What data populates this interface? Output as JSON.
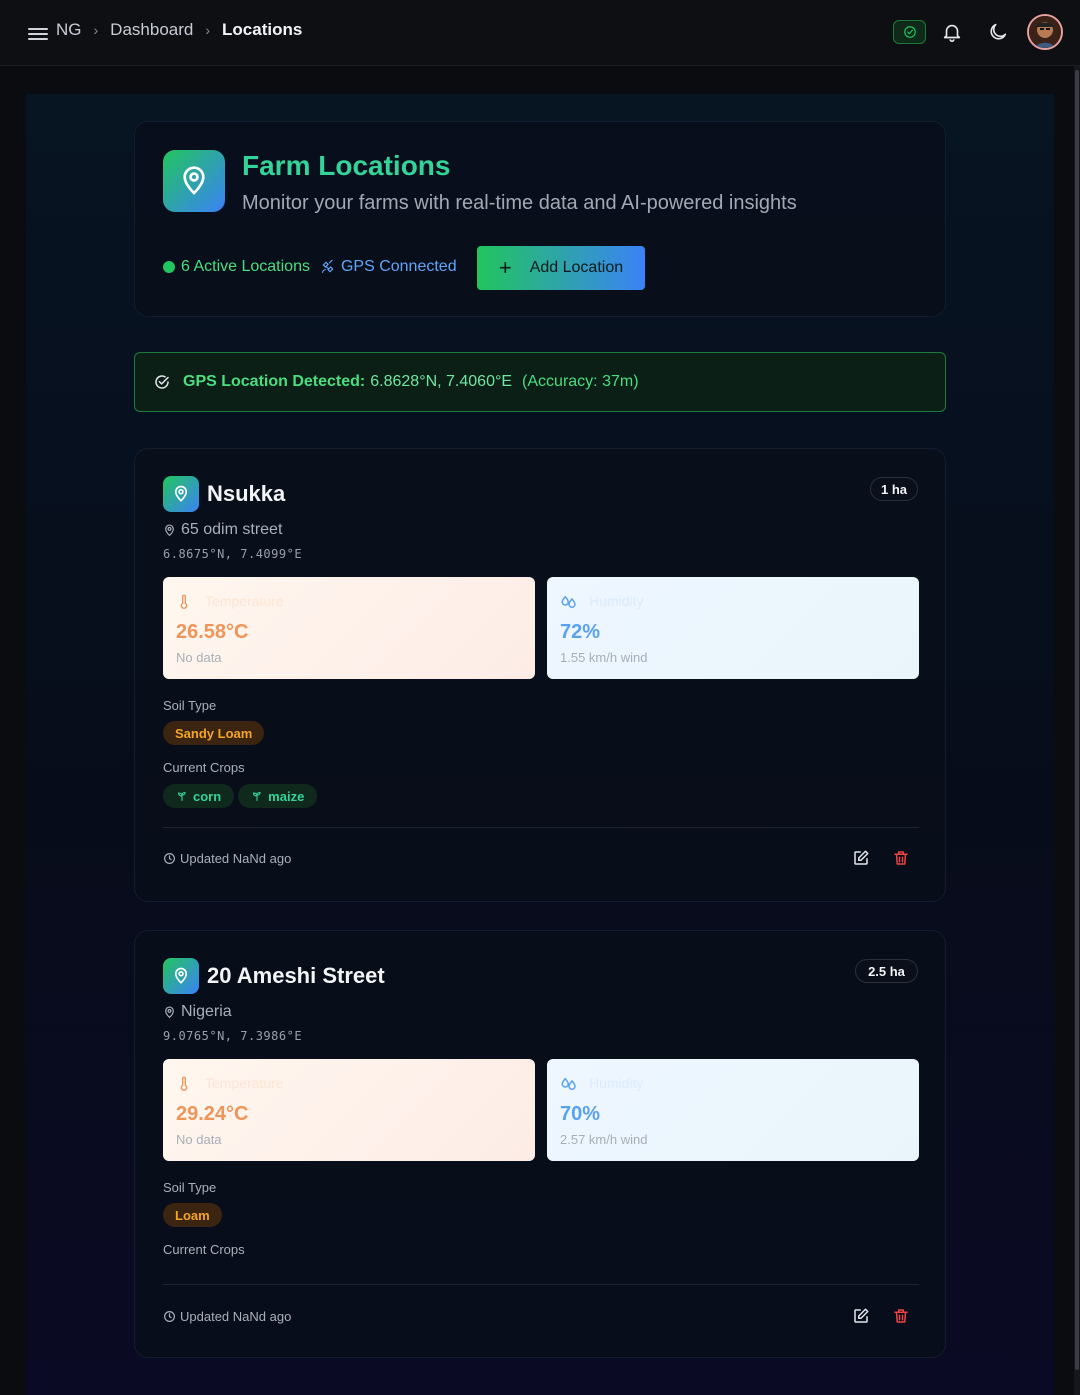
{
  "breadcrumb": {
    "root": "NG",
    "parent": "Dashboard",
    "current": "Locations"
  },
  "colors": {
    "accent_green": "#22c55e",
    "accent_blue": "#3b82f6",
    "delete_red": "#ef4444",
    "soil_amber": "#f5a524"
  },
  "header": {
    "title": "Farm Locations",
    "subtitle": "Monitor your farms with real-time data and AI-powered insights",
    "active_locations": "6 Active Locations",
    "gps_status": "GPS Connected",
    "add_button": "Add Location"
  },
  "gps_banner": {
    "label": "GPS Location Detected:",
    "coords": "6.8628°N, 7.4060°E",
    "accuracy": "(Accuracy: 37m)"
  },
  "locations": [
    {
      "name": "Nsukka",
      "area": "1 ha",
      "address": "65 odim street",
      "coords": "6.8675°N, 7.4099°E",
      "temperature": {
        "label": "Temperature",
        "value": "26.58°C",
        "sub": "No data"
      },
      "humidity": {
        "label": "Humidity",
        "value": "72%",
        "sub": "1.55 km/h wind"
      },
      "soil_label": "Soil Type",
      "soil": "Sandy Loam",
      "crops_label": "Current Crops",
      "crops": [
        "corn",
        "maize"
      ],
      "updated": "Updated NaNd ago"
    },
    {
      "name": "20 Ameshi Street",
      "area": "2.5 ha",
      "address": "Nigeria",
      "coords": "9.0765°N, 7.3986°E",
      "temperature": {
        "label": "Temperature",
        "value": "29.24°C",
        "sub": "No data"
      },
      "humidity": {
        "label": "Humidity",
        "value": "70%",
        "sub": "2.57 km/h wind"
      },
      "soil_label": "Soil Type",
      "soil": "Loam",
      "crops_label": "Current Crops",
      "crops": [],
      "updated": "Updated NaNd ago"
    }
  ]
}
